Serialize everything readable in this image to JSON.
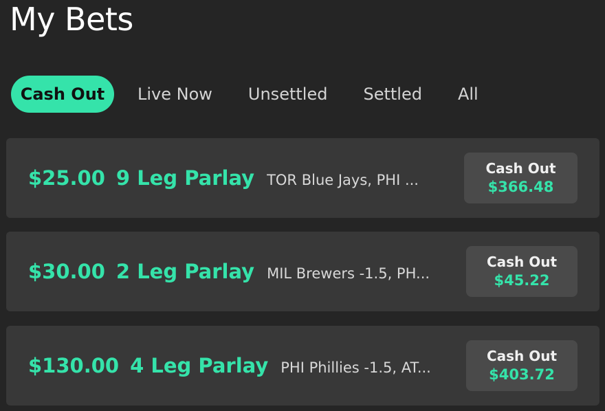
{
  "page": {
    "title": "My Bets"
  },
  "tabs": [
    {
      "label": "Cash Out",
      "active": true
    },
    {
      "label": "Live Now",
      "active": false
    },
    {
      "label": "Unsettled",
      "active": false
    },
    {
      "label": "Settled",
      "active": false
    },
    {
      "label": "All",
      "active": false
    }
  ],
  "bets": [
    {
      "stake": "$25.00",
      "type": "9 Leg Parlay",
      "legs": "TOR Blue Jays, PHI ...",
      "cashout_label": "Cash Out",
      "cashout_amount": "$366.48"
    },
    {
      "stake": "$30.00",
      "type": "2 Leg Parlay",
      "legs": "MIL Brewers -1.5, PH...",
      "cashout_label": "Cash Out",
      "cashout_amount": "$45.22"
    },
    {
      "stake": "$130.00",
      "type": "4 Leg Parlay",
      "legs": "PHI Phillies -1.5, AT...",
      "cashout_label": "Cash Out",
      "cashout_amount": "$403.72"
    }
  ],
  "colors": {
    "accent": "#35e3aa",
    "background": "#252525",
    "card": "#383838",
    "button": "#4a4a4a"
  }
}
